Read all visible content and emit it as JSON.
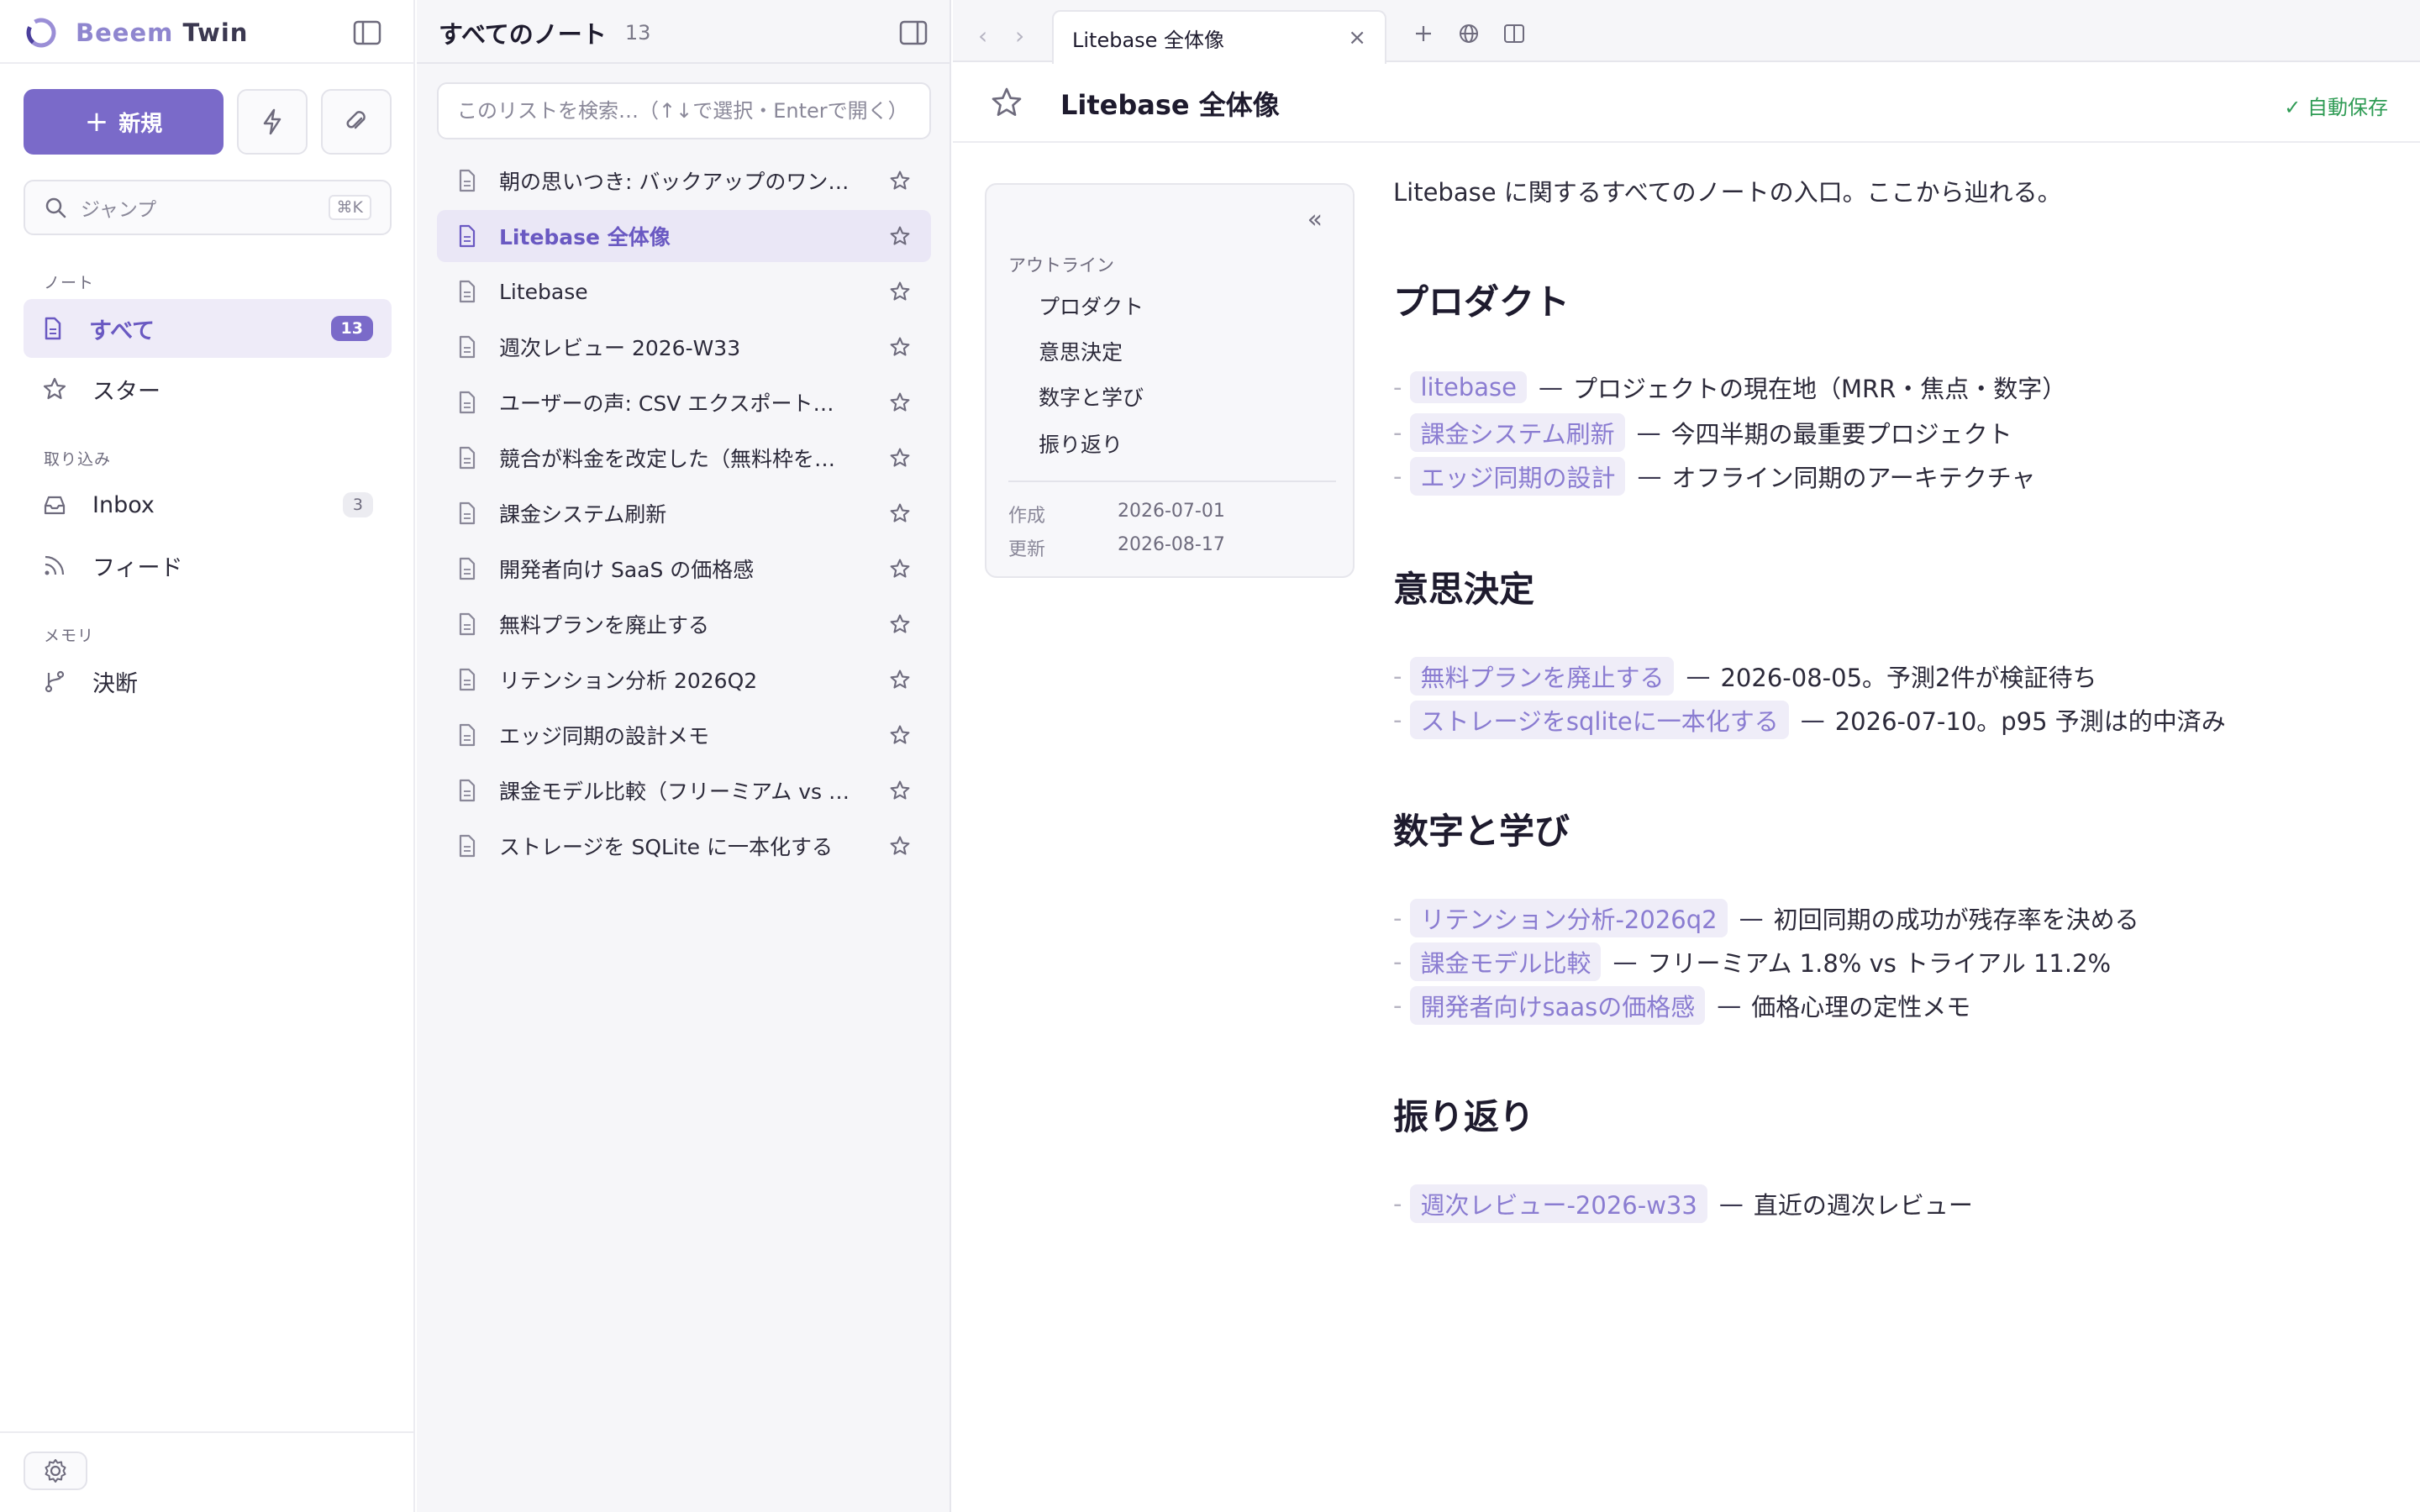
{
  "sidebar": {
    "brand_first": "Beeem",
    "brand_second": "Twin",
    "new_button": "新規",
    "jump_placeholder": "ジャンプ",
    "jump_shortcut": "⌘K",
    "sections": {
      "notes": "ノート",
      "import": "取り込み",
      "memory": "メモリ"
    },
    "items": [
      {
        "label": "すべて",
        "count": "13",
        "icon": "file-icon"
      },
      {
        "label": "スター",
        "icon": "star-icon"
      },
      {
        "label": "Inbox",
        "count": "3",
        "icon": "inbox-icon"
      },
      {
        "label": "フィード",
        "icon": "rss-icon"
      },
      {
        "label": "決断",
        "icon": "branch-icon"
      }
    ]
  },
  "notes_list": {
    "title": "すべてのノート",
    "count": "13",
    "search_placeholder": "このリストを検索…（↑↓で選択・Enterで開く）",
    "items": [
      "朝の思いつき: バックアップのワンクリック化",
      "Litebase 全体像",
      "Litebase",
      "週次レビュー 2026-W33",
      "ユーザーの声: CSV エクスポートが欲しい",
      "競合が料金を改定した（無料枠を縮小）",
      "課金システム刷新",
      "開発者向け SaaS の価格感",
      "無料プランを廃止する",
      "リテンション分析 2026Q2",
      "エッジ同期の設計メモ",
      "課金モデル比較（フリーミアム vs トライアル）",
      "ストレージを SQLite に一本化する"
    ],
    "active_index": 1
  },
  "tabs": [
    {
      "title": "Litebase 全体像",
      "active": true
    }
  ],
  "note": {
    "title": "Litebase 全体像",
    "autosave": "✓ 自動保存",
    "outline": {
      "label": "アウトライン",
      "items": [
        "プロダクト",
        "意思決定",
        "数字と学び",
        "振り返り"
      ],
      "created_label": "作成",
      "created": "2026-07-01",
      "updated_label": "更新",
      "updated": "2026-08-17"
    },
    "intro": "Litebase に関するすべてのノートの入口。ここから辿れる。",
    "sections": [
      {
        "heading": "プロダクト",
        "bullets": [
          {
            "link": "litebase",
            "text": "プロジェクトの現在地（MRR・焦点・数字）"
          },
          {
            "link": "課金システム刷新",
            "text": "今四半期の最重要プロジェクト"
          },
          {
            "link": "エッジ同期の設計",
            "text": "オフライン同期のアーキテクチャ"
          }
        ]
      },
      {
        "heading": "意思決定",
        "bullets": [
          {
            "link": "無料プランを廃止する",
            "text": "2026-08-05。予測2件が検証待ち"
          },
          {
            "link": "ストレージをsqliteに一本化する",
            "text": "2026-07-10。p95 予測は的中済み"
          }
        ]
      },
      {
        "heading": "数字と学び",
        "bullets": [
          {
            "link": "リテンション分析-2026q2",
            "text": "初回同期の成功が残存率を決める"
          },
          {
            "link": "課金モデル比較",
            "text": "フリーミアム 1.8% vs トライアル 11.2%"
          },
          {
            "link": "開発者向けsaasの価格感",
            "text": "価格心理の定性メモ"
          }
        ]
      },
      {
        "heading": "振り返り",
        "bullets": [
          {
            "link": "週次レビュー-2026-w33",
            "text": "直近の週次レビュー"
          }
        ]
      }
    ]
  },
  "colors": {
    "accent": "#7a6ac9",
    "accent_light": "#eeebf8",
    "link": "#8a7cd1",
    "autosave": "#2e9b54"
  }
}
